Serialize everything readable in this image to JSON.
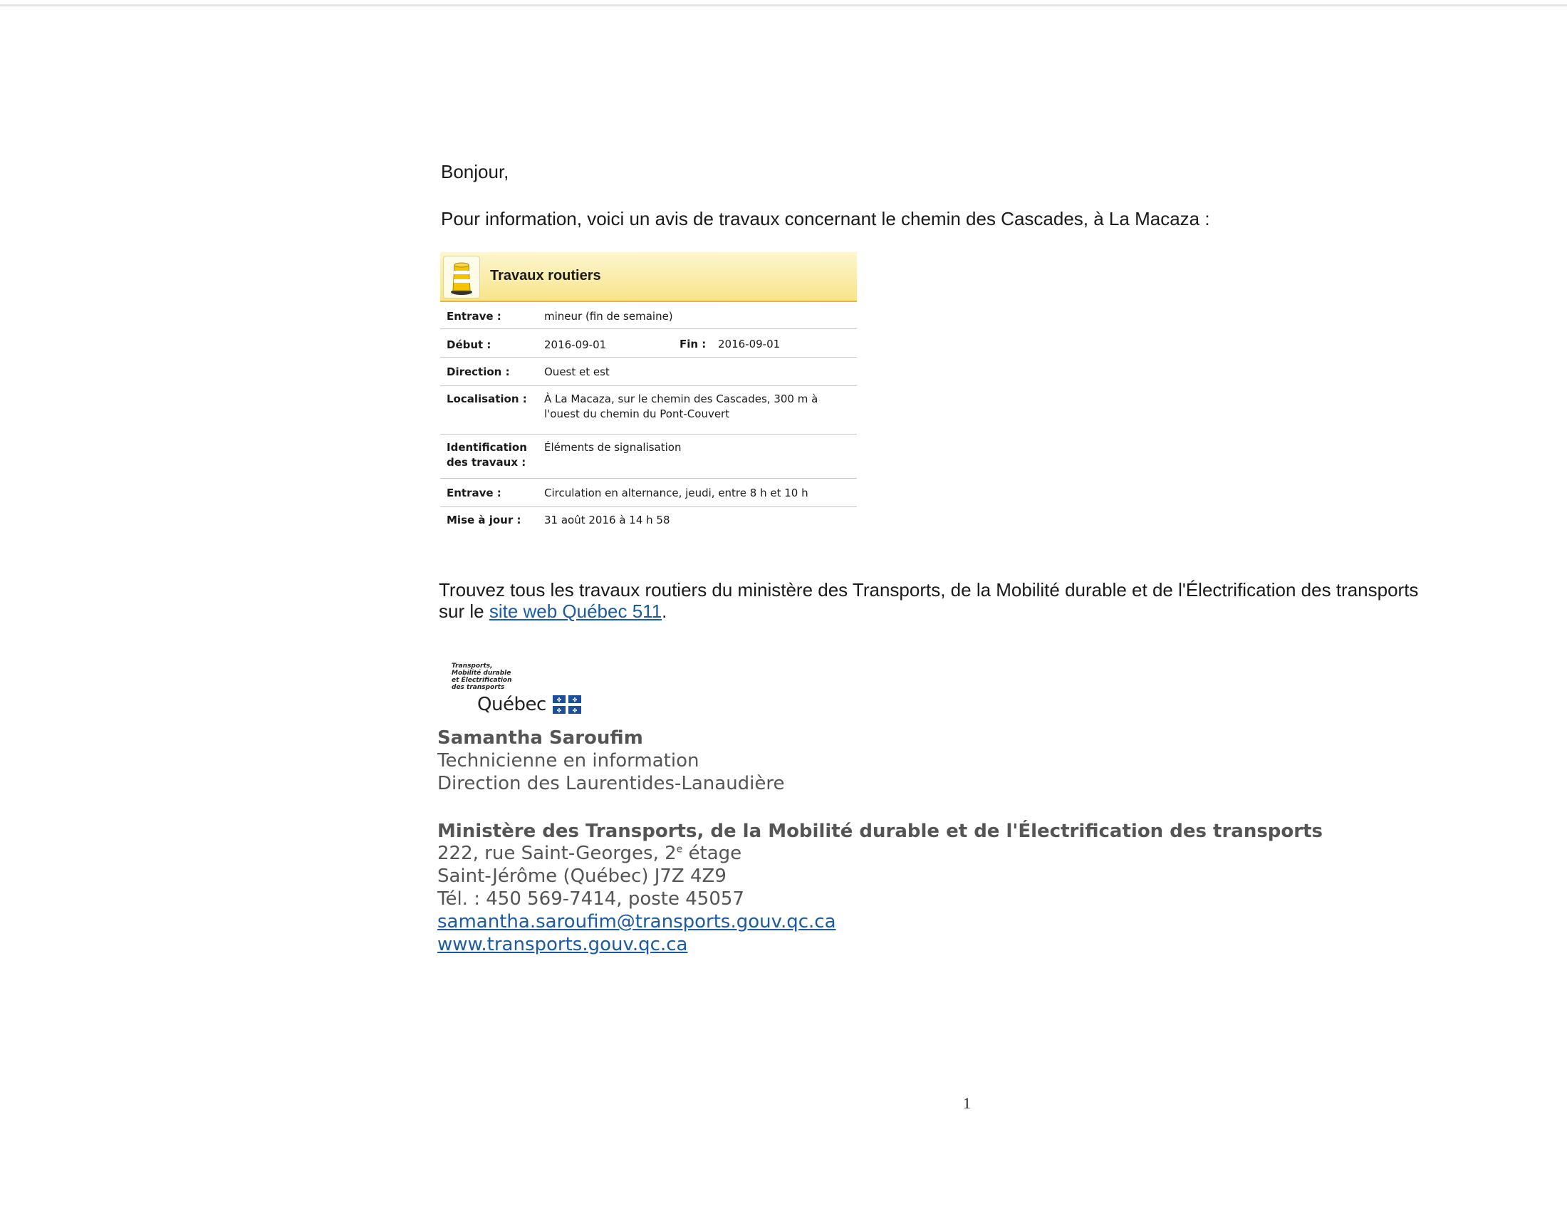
{
  "letter": {
    "greeting": "Bonjour,",
    "intro": "Pour information, voici un avis de travaux concernant le chemin des Cascades, à La Macaza :"
  },
  "notice": {
    "title": "Travaux routiers",
    "icon": "traffic-barrel-icon",
    "rows": {
      "entrave1": {
        "label": "Entrave :",
        "value": "mineur (fin de semaine)"
      },
      "debut": {
        "label": "Début :",
        "value": "2016-09-01"
      },
      "fin": {
        "label": "Fin :",
        "value": "2016-09-01"
      },
      "direction": {
        "label": "Direction :",
        "value": "Ouest et est"
      },
      "localisation": {
        "label": "Localisation :",
        "line1": "À La Macaza, sur le chemin des Cascades, 300 m à",
        "line2": "l'ouest du chemin du Pont-Couvert"
      },
      "identification": {
        "label1": "Identification",
        "label2": "des travaux :",
        "value": "Éléments de signalisation"
      },
      "entrave2": {
        "label": "Entrave :",
        "value": "Circulation en alternance, jeudi, entre 8 h et 10 h"
      },
      "miseajour": {
        "label": "Mise à jour :",
        "value": "31 août 2016 à 14 h 58"
      }
    },
    "colors": {
      "header_top": "#fdf6cf",
      "header_bottom": "#f8e48a",
      "rule": "#e8c66a"
    }
  },
  "find": {
    "line1": "Trouvez tous les travaux routiers du ministère des Transports, de la Mobilité durable et de l'Électrification des transports",
    "prefix": "sur le ",
    "link": "site web Québec 511",
    "suffix": "."
  },
  "logo": {
    "line1": "Transports,",
    "line2": "Mobilité durable",
    "line3": "et Électrification",
    "line4": "des transports",
    "name": "Québec",
    "flag_color": "#1b4f9c"
  },
  "signature": {
    "name": "Samantha Saroufim",
    "title": "Technicienne en information",
    "direction": "Direction des Laurentides-Lanaudière",
    "ministry": "Ministère des Transports, de la Mobilité durable et de l'Électrification des transports",
    "address_pre": "222, rue Saint-Georges, 2",
    "address_sup": "e",
    "address_post": " étage",
    "city": "Saint-Jérôme (Québec)  J7Z 4Z9",
    "phone": "Tél. : 450 569-7414, poste 45057",
    "email": "samantha.saroufim@transports.gouv.qc.ca",
    "website": "www.transports.gouv.qc.ca"
  },
  "page_number": "1"
}
